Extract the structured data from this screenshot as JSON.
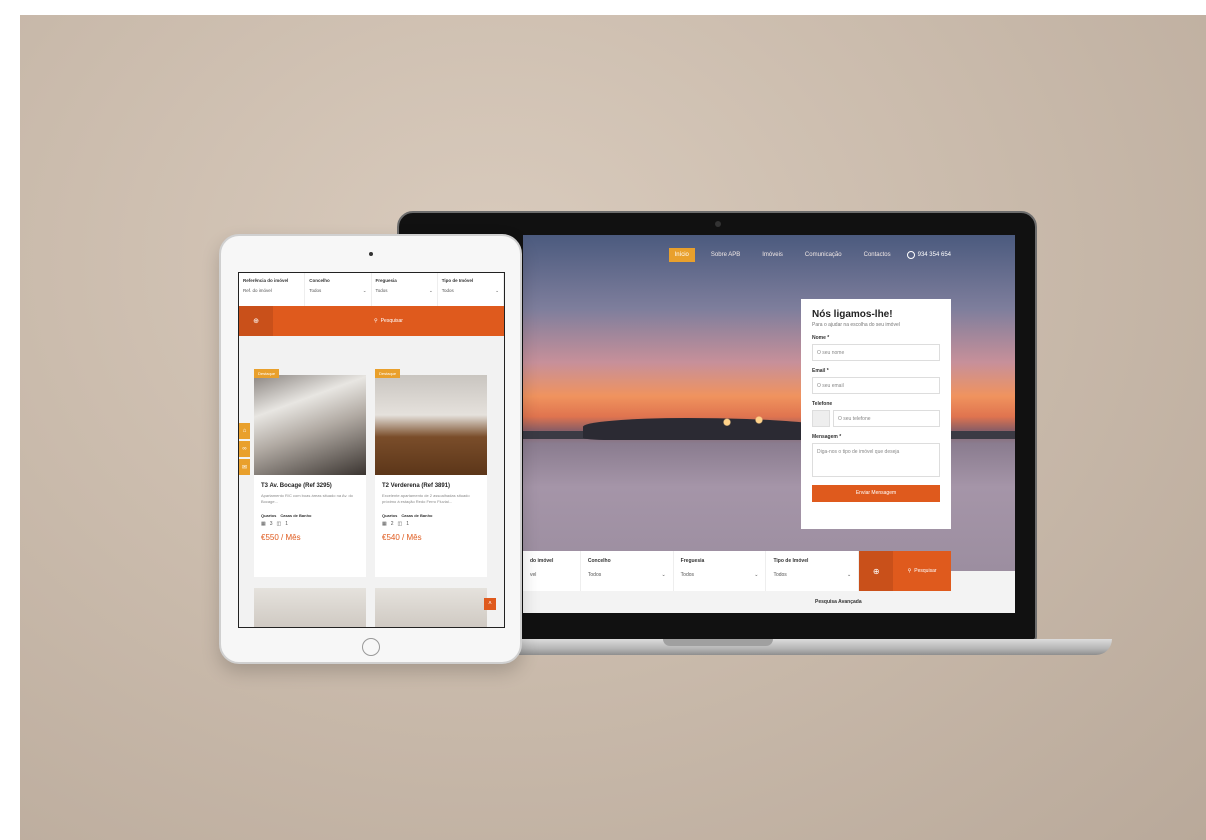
{
  "laptop": {
    "nav": [
      "Início",
      "Sobre APB",
      "Imóveis",
      "Comunicação",
      "Contactos"
    ],
    "phone": "934 354 654",
    "callback": {
      "title": "Nós ligamos-lhe!",
      "subtitle": "Para o ajudar na escolha do seu imóvel",
      "name_label": "Nome *",
      "name_placeholder": "O seu nome",
      "email_label": "Email *",
      "email_placeholder": "O seu email",
      "phone_label": "Telefone",
      "phone_placeholder": "O seu telefone",
      "message_label": "Mensagem *",
      "message_placeholder": "Diga-nos o tipo de imóvel que deseja",
      "submit": "Enviar Mensagem"
    },
    "search": {
      "ref_label": "do imóvel",
      "ref_value": "vel",
      "concelho_label": "Concelho",
      "concelho_value": "Todos",
      "freguesia_label": "Freguesia",
      "freguesia_value": "Todos",
      "tipo_label": "Tipo de Imóvel",
      "tipo_value": "Todos",
      "button": "Pesquisar",
      "advanced": "Pesquisa Avançada"
    }
  },
  "tablet": {
    "search": {
      "ref_label": "Referência do imóvel",
      "ref_value": "Ref. do imóvel",
      "concelho_label": "Concelho",
      "concelho_value": "Todos",
      "freguesia_label": "Freguesia",
      "freguesia_value": "Todos",
      "tipo_label": "Tipo de Imóvel",
      "tipo_value": "Todos",
      "button": "Pesquisar"
    },
    "cards": [
      {
        "badge": "Destaque",
        "title": "T3 Av. Bocage (Ref 3295)",
        "desc": "Apartamento R/C com boas áreas situado na Av. do Bocage...",
        "quartos_label": "Quartos",
        "wc_label": "Casas de Banho",
        "quartos": "3",
        "wc": "1",
        "price": "€550 / Mês"
      },
      {
        "badge": "Destaque",
        "title": "T2 Verderena (Ref 3891)",
        "desc": "Excelente apartamento de 2 assoalhadas situado próximo à estação Redo Ferro Fluvial...",
        "quartos_label": "Quartos",
        "wc_label": "Casas de Banho",
        "quartos": "2",
        "wc": "1",
        "price": "€540 / Mês"
      }
    ]
  }
}
